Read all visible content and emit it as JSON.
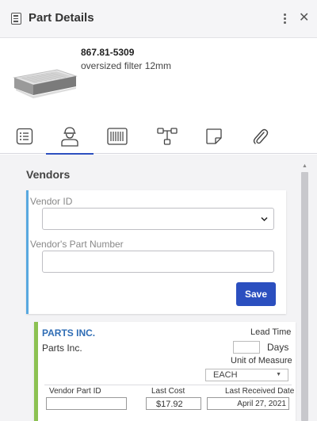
{
  "header": {
    "title": "Part Details",
    "icon": "document-list-icon",
    "menu_icon": "kebab-menu-icon",
    "close_label": "✕"
  },
  "product": {
    "part_number": "867.81-5309",
    "description": "oversized filter 12mm",
    "image": "filter-image"
  },
  "tabs": [
    {
      "icon": "list-icon",
      "active": false
    },
    {
      "icon": "vendor-person-icon",
      "active": true
    },
    {
      "icon": "barcode-icon",
      "active": false
    },
    {
      "icon": "hierarchy-icon",
      "active": false
    },
    {
      "icon": "note-icon",
      "active": false
    },
    {
      "icon": "paperclip-icon",
      "active": false
    }
  ],
  "vendors": {
    "title": "Vendors",
    "form": {
      "vendor_id_label": "Vendor ID",
      "vendor_id_value": "",
      "vendor_part_number_label": "Vendor's Part Number",
      "vendor_part_number_value": "",
      "save_label": "Save"
    },
    "card": {
      "name": "PARTS INC.",
      "subtitle": "Parts Inc.",
      "lead_time_label": "Lead Time",
      "lead_time_value": "",
      "days_label": "Days",
      "uom_label": "Unit of Measure",
      "uom_value": "EACH",
      "vendor_part_id_label": "Vendor Part ID",
      "vendor_part_id_value": "",
      "last_cost_label": "Last Cost",
      "last_cost_value": "$17.92",
      "last_received_label": "Last Received Date",
      "last_received_value": "April 27, 2021"
    }
  },
  "colors": {
    "accent": "#2b4fbf",
    "form_border": "#58a8e0",
    "vendor_border": "#8cc152",
    "vendor_name": "#2f6db5"
  }
}
